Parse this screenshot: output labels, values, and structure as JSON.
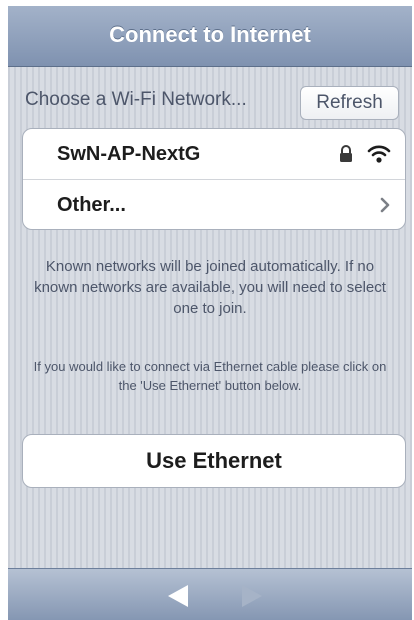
{
  "header": {
    "title": "Connect to Internet"
  },
  "wifi": {
    "choose_label": "Choose a Wi-Fi Network...",
    "refresh_label": "Refresh",
    "networks": [
      {
        "name": "SwN-AP-NextG",
        "icons": [
          "lock-icon",
          "wifi-icon"
        ]
      },
      {
        "name": "Other...",
        "icons": [
          "chevron-right-icon"
        ]
      }
    ]
  },
  "info": {
    "known_networks": "Known networks will be joined automatically. If no known networks are available, you will need to select one to join.",
    "ethernet_hint": "If you would like to connect via Ethernet cable please click on the 'Use Ethernet' button below."
  },
  "ethernet": {
    "button_label": "Use Ethernet"
  },
  "toolbar": {
    "back_icon": "back-arrow-icon",
    "forward_icon": "forward-arrow-icon",
    "forward_enabled": false
  },
  "colors": {
    "title_bar": "#8fa0bb",
    "text_muted": "#4d566a",
    "background_stripe": "#d1d6de"
  }
}
